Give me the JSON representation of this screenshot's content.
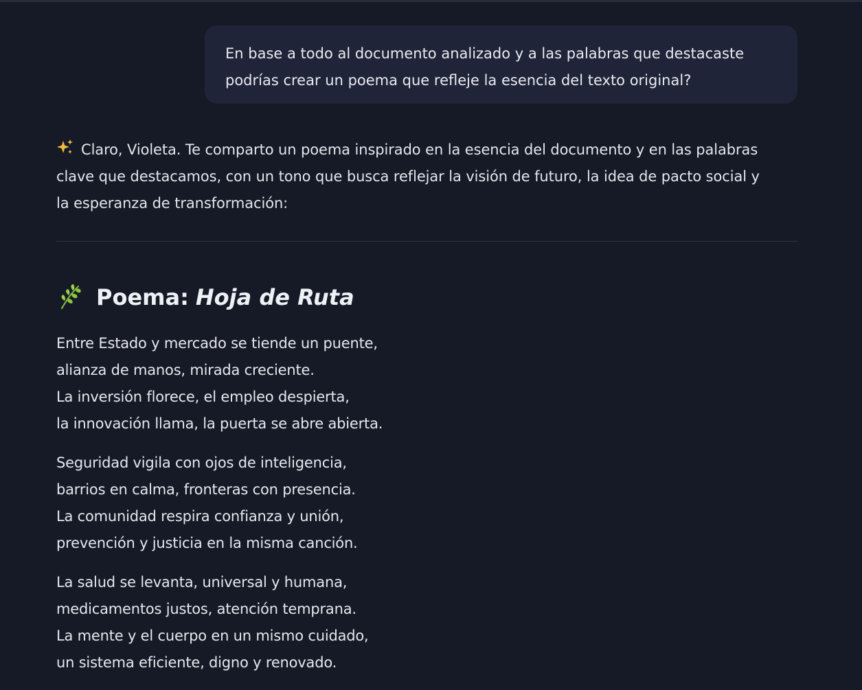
{
  "user_message": {
    "text_line1": "En base a todo al documento analizado y a las palabras que destacaste",
    "text_line2": "podrías crear un poema que refleje la esencia del texto original?"
  },
  "assistant": {
    "intro_icon": "sparkles-icon",
    "intro_line1": "Claro, Violeta. Te comparto un poema inspirado en la esencia del documento y en las palabras",
    "intro_line2": "clave que destacamos, con un tono que busca reflejar la visión de futuro, la idea de pacto social y",
    "intro_line3": "la esperanza de transformación:",
    "poem_icon": "herb-leaf-icon",
    "poem_title_prefix": "Poema:",
    "poem_title_italic": "Hoja de Ruta",
    "stanzas": [
      [
        "Entre Estado y mercado se tiende un puente,",
        "alianza de manos, mirada creciente.",
        "La inversión florece, el empleo despierta,",
        "la innovación llama, la puerta se abre abierta."
      ],
      [
        "Seguridad vigila con ojos de inteligencia,",
        "barrios en calma, fronteras con presencia.",
        "La comunidad respira confianza y unión,",
        "prevención y justicia en la misma canción."
      ],
      [
        "La salud se levanta, universal y humana,",
        "medicamentos justos, atención temprana.",
        "La mente y el cuerpo en un mismo cuidado,",
        "un sistema eficiente, digno y renovado."
      ]
    ]
  },
  "colors": {
    "background": "#151a26",
    "user_bubble": "#1f2438",
    "text": "#e6e8ee",
    "divider": "#2e3444"
  }
}
